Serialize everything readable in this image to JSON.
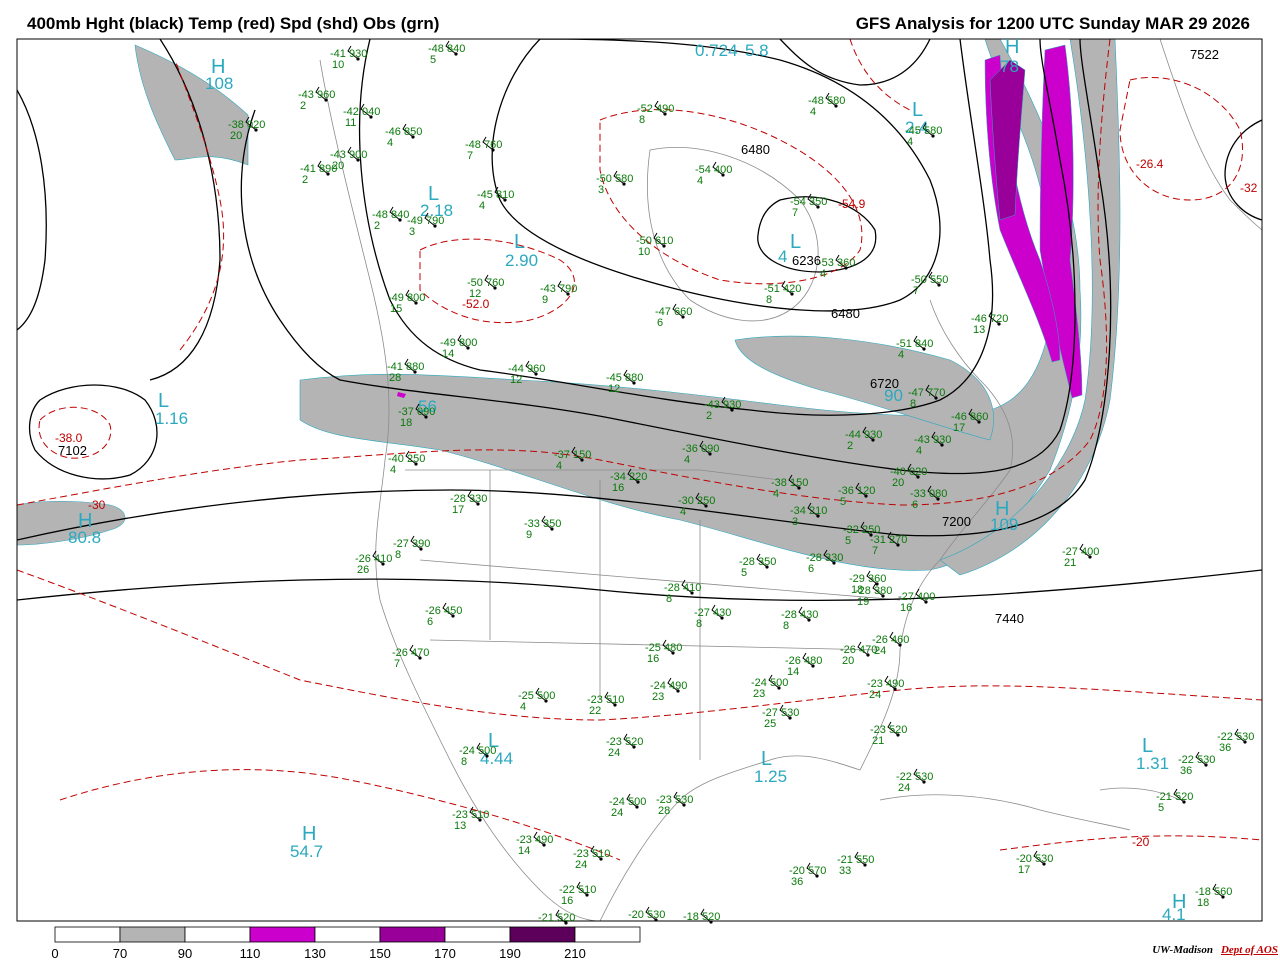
{
  "header": {
    "left_title": "400mb Hght (black) Temp (red) Spd (shd) Obs (grn)",
    "right_title": "GFS Analysis for 1200 UTC Sunday  MAR 29 2026"
  },
  "credit": {
    "org": "UW-Madison",
    "dept": "Dept of AOS"
  },
  "colors": {
    "height_contour": "#000000",
    "temp_contour": "#c00000",
    "speed_70_90": "#b4b4b4",
    "speed_110_130": "#cc00cc",
    "speed_150_170": "#990099",
    "speed_190_210": "#5c005c",
    "obs": "#0a7a0a",
    "centers": "#2ba9bf"
  },
  "legend": {
    "ticks": [
      "0",
      "70",
      "90",
      "110",
      "130",
      "150",
      "170",
      "190",
      "210"
    ]
  },
  "contour_labels": {
    "heights": [
      "7522",
      "6480",
      "6236",
      "6480",
      "6720",
      "7102",
      "7200",
      "7440"
    ],
    "temps": [
      "-26.4",
      "-32",
      "-54.9",
      "-52.0",
      "-38.0",
      "-30",
      "-20"
    ]
  },
  "centers": [
    {
      "letter": "H",
      "value": "108"
    },
    {
      "letter": "L",
      "value": "0.724"
    },
    {
      "letter": "L",
      "value": "5.8"
    },
    {
      "letter": "H",
      "value": "78"
    },
    {
      "letter": "L",
      "value": "2.4"
    },
    {
      "letter": "L",
      "value": "2.18"
    },
    {
      "letter": "L",
      "value": "2.90"
    },
    {
      "letter": "L",
      "value": "4"
    },
    {
      "letter": "L",
      "value": "1.16"
    },
    {
      "letter": "H",
      "value": "80.8"
    },
    {
      "letter": "H",
      "value": "109"
    },
    {
      "letter": "L",
      "value": "90"
    },
    {
      "letter": "L",
      "value": "4.44"
    },
    {
      "letter": "L",
      "value": "1.25"
    },
    {
      "letter": "L",
      "value": "1.31"
    },
    {
      "letter": "H",
      "value": "54.7"
    },
    {
      "letter": "H",
      "value": "4.1"
    },
    {
      "letter": "L",
      "value": "56"
    }
  ],
  "observations": [
    {
      "text": "-41 930",
      "sub": "10"
    },
    {
      "text": "-48 840",
      "sub": "5"
    },
    {
      "text": "-43 960",
      "sub": "2"
    },
    {
      "text": "-42 040",
      "sub": "11"
    },
    {
      "text": "-38 020",
      "sub": "20"
    },
    {
      "text": "-46 850",
      "sub": "4"
    },
    {
      "text": "-43 900",
      "sub": "20"
    },
    {
      "text": "-41 890",
      "sub": "2"
    },
    {
      "text": "-48 760",
      "sub": "7"
    },
    {
      "text": "-45 810",
      "sub": "4"
    },
    {
      "text": "-48 840",
      "sub": "2"
    },
    {
      "text": "-49 790",
      "sub": "3"
    },
    {
      "text": "-52 490",
      "sub": "8"
    },
    {
      "text": "-54 400",
      "sub": "4"
    },
    {
      "text": "-50 580",
      "sub": "3"
    },
    {
      "text": "-48 580",
      "sub": "4"
    },
    {
      "text": "-45 580",
      "sub": "4"
    },
    {
      "text": "-54 350",
      "sub": "7"
    },
    {
      "text": "-50 610",
      "sub": "10"
    },
    {
      "text": "-50 760",
      "sub": "12"
    },
    {
      "text": "-43 790",
      "sub": "9"
    },
    {
      "text": "-53 360",
      "sub": "4"
    },
    {
      "text": "-51 420",
      "sub": "8"
    },
    {
      "text": "-50 550",
      "sub": "7"
    },
    {
      "text": "-49 800",
      "sub": "15"
    },
    {
      "text": "-47 660",
      "sub": "6"
    },
    {
      "text": "-46 720",
      "sub": "13"
    },
    {
      "text": "-49 800",
      "sub": "14"
    },
    {
      "text": "-51 840",
      "sub": "4"
    },
    {
      "text": "-41 880",
      "sub": "28"
    },
    {
      "text": "-44 960",
      "sub": "12"
    },
    {
      "text": "-45 880",
      "sub": "12"
    },
    {
      "text": "-47 770",
      "sub": "8"
    },
    {
      "text": "-43 930",
      "sub": "2"
    },
    {
      "text": "-46 860",
      "sub": "17"
    },
    {
      "text": "-37 090",
      "sub": "18"
    },
    {
      "text": "-44 930",
      "sub": "2"
    },
    {
      "text": "-43 930",
      "sub": "4"
    },
    {
      "text": "-40 250",
      "sub": "4"
    },
    {
      "text": "-37 150",
      "sub": "4"
    },
    {
      "text": "-36 090",
      "sub": "4"
    },
    {
      "text": "-40 020",
      "sub": "20"
    },
    {
      "text": "-34 220",
      "sub": "16"
    },
    {
      "text": "-38 150",
      "sub": "4"
    },
    {
      "text": "-36 120",
      "sub": "5"
    },
    {
      "text": "-33 080",
      "sub": "6"
    },
    {
      "text": "-28 330",
      "sub": "17"
    },
    {
      "text": "-30 250",
      "sub": "4"
    },
    {
      "text": "-34 210",
      "sub": "3"
    },
    {
      "text": "-32 250",
      "sub": "5"
    },
    {
      "text": "-31 270",
      "sub": "7"
    },
    {
      "text": "-33 350",
      "sub": "9"
    },
    {
      "text": "-27 390",
      "sub": "8"
    },
    {
      "text": "-26 410",
      "sub": "26"
    },
    {
      "text": "-27 400",
      "sub": "21"
    },
    {
      "text": "-28 350",
      "sub": "5"
    },
    {
      "text": "-28 330",
      "sub": "6"
    },
    {
      "text": "-29 360",
      "sub": "18"
    },
    {
      "text": "-28 380",
      "sub": "19"
    },
    {
      "text": "-27 400",
      "sub": "16"
    },
    {
      "text": "-28 410",
      "sub": "8"
    },
    {
      "text": "-27 430",
      "sub": "8"
    },
    {
      "text": "-28 430",
      "sub": "8"
    },
    {
      "text": "-26 450",
      "sub": "6"
    },
    {
      "text": "-25 480",
      "sub": "16"
    },
    {
      "text": "-26 480",
      "sub": "14"
    },
    {
      "text": "-26 470",
      "sub": "20"
    },
    {
      "text": "-26 460",
      "sub": "24"
    },
    {
      "text": "-26 470",
      "sub": "7"
    },
    {
      "text": "-23 490",
      "sub": "24"
    },
    {
      "text": "-24 500",
      "sub": "23"
    },
    {
      "text": "-24 490",
      "sub": "23"
    },
    {
      "text": "-25 500",
      "sub": "4"
    },
    {
      "text": "-23 510",
      "sub": "22"
    },
    {
      "text": "-27 530",
      "sub": "25"
    },
    {
      "text": "-23 520",
      "sub": "21"
    },
    {
      "text": "-23 520",
      "sub": "24"
    },
    {
      "text": "-22 530",
      "sub": "24"
    },
    {
      "text": "-24 500",
      "sub": "8"
    },
    {
      "text": "-22 530",
      "sub": "36"
    },
    {
      "text": "-22 530",
      "sub": "36"
    },
    {
      "text": "-21 520",
      "sub": "5"
    },
    {
      "text": "-23 510",
      "sub": "13"
    },
    {
      "text": "-24 500",
      "sub": "24"
    },
    {
      "text": "-23 530",
      "sub": "28"
    },
    {
      "text": "-23 490",
      "sub": "14"
    },
    {
      "text": "-23 510",
      "sub": "24"
    },
    {
      "text": "-22 510",
      "sub": "16"
    },
    {
      "text": "-20 570",
      "sub": "36"
    },
    {
      "text": "-21 550",
      "sub": "33"
    },
    {
      "text": "-20 530",
      "sub": "17"
    },
    {
      "text": "-18 560",
      "sub": "18"
    },
    {
      "text": "-21 520",
      "sub": ""
    },
    {
      "text": "-20 530",
      "sub": ""
    },
    {
      "text": "-18 520",
      "sub": ""
    }
  ]
}
